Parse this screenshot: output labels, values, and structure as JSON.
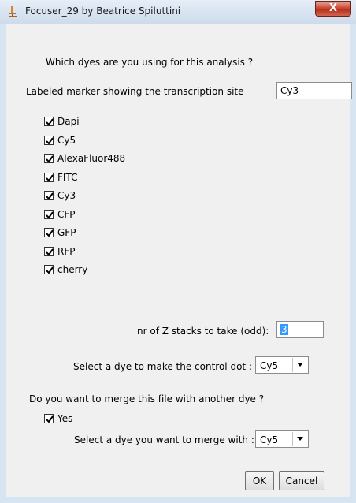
{
  "window": {
    "title": "Focuser_29 by Beatrice Spiluttini",
    "close_label": "X"
  },
  "dyes_question": "Which dyes are you using for this analysis ?",
  "marker": {
    "label": "Labeled marker showing the transcription site",
    "value": "Cy3"
  },
  "dyes": [
    {
      "label": "Dapi",
      "checked": true
    },
    {
      "label": "Cy5",
      "checked": true
    },
    {
      "label": "AlexaFluor488",
      "checked": true
    },
    {
      "label": "FITC",
      "checked": true
    },
    {
      "label": "Cy3",
      "checked": true
    },
    {
      "label": "CFP",
      "checked": true
    },
    {
      "label": "GFP",
      "checked": true
    },
    {
      "label": "RFP",
      "checked": true
    },
    {
      "label": "cherry",
      "checked": true
    }
  ],
  "zstacks": {
    "label": "nr of Z stacks to take (odd):",
    "value": "3"
  },
  "control_dot": {
    "label": "Select a dye to make the control dot :",
    "value": "Cy5"
  },
  "merge": {
    "question": "Do you want to merge this file with another dye ?",
    "yes_label": "Yes",
    "yes_checked": true,
    "select_label": "Select a dye you want to merge with :",
    "select_value": "Cy5"
  },
  "buttons": {
    "ok": "OK",
    "cancel": "Cancel"
  },
  "colors": {
    "title_bar": "#cddbeb",
    "close_button": "#c7402a",
    "selection": "#3399ff",
    "dialog_bg": "#f0f0f0"
  }
}
